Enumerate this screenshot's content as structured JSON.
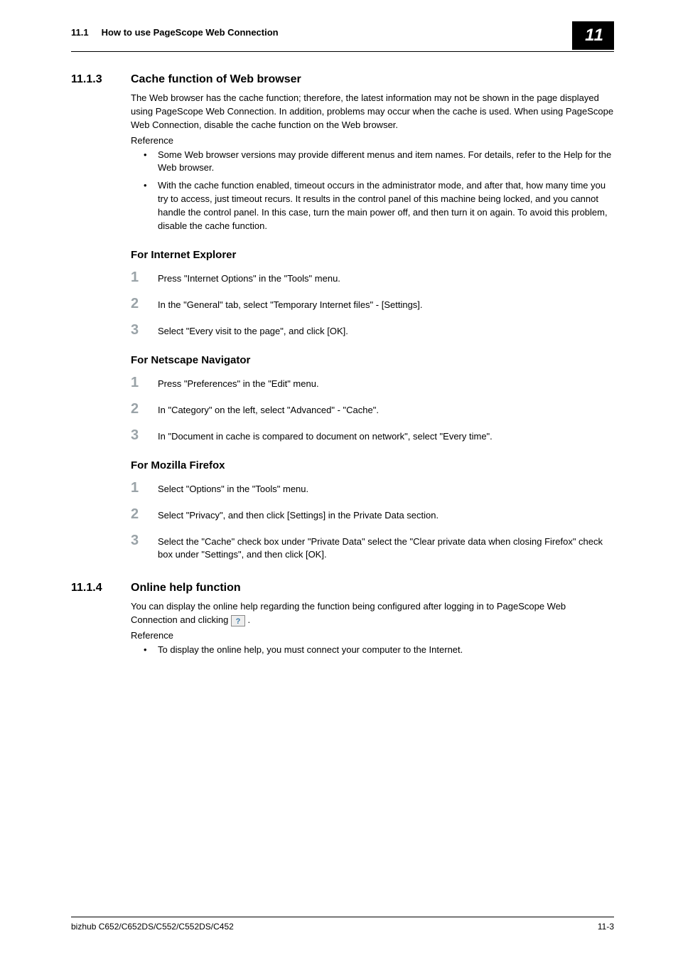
{
  "header": {
    "section_num": "11.1",
    "section_title": "How to use PageScope Web Connection",
    "chapter": "11"
  },
  "sec1": {
    "num": "11.1.3",
    "title": "Cache function of Web browser",
    "intro": "The Web browser has the cache function; therefore, the latest information may not be shown in the page displayed using PageScope Web Connection. In addition, problems may occur when the cache is used. When using PageScope Web Connection, disable the cache function on the Web browser.",
    "reference_label": "Reference",
    "bullets": [
      "Some Web browser versions may provide different menus and item names. For details, refer to the Help for the Web browser.",
      "With the cache function enabled, timeout occurs in the administrator mode, and after that, how many time you try to access, just timeout recurs. It results in the control panel of this machine being locked, and you cannot handle the control panel. In this case, turn the main power off, and then turn it on again. To avoid this problem, disable the cache function."
    ],
    "ie": {
      "title": "For Internet Explorer",
      "steps": [
        "Press \"Internet Options\" in the \"Tools\" menu.",
        "In the \"General\" tab, select \"Temporary Internet files\" - [Settings].",
        "Select \"Every visit to the page\", and click [OK]."
      ]
    },
    "netscape": {
      "title": "For Netscape Navigator",
      "steps": [
        "Press \"Preferences\" in the \"Edit\" menu.",
        "In \"Category\" on the left, select \"Advanced\" - \"Cache\".",
        "In \"Document in cache is compared to document on network\", select \"Every time\"."
      ]
    },
    "firefox": {
      "title": "For Mozilla Firefox",
      "steps": [
        "Select \"Options\" in the \"Tools\" menu.",
        "Select \"Privacy\", and then click [Settings] in the Private Data section.",
        "Select the \"Cache\" check box under \"Private Data\" select the \"Clear private data when closing Firefox\" check box under \"Settings\", and then click [OK]."
      ]
    }
  },
  "sec2": {
    "num": "11.1.4",
    "title": "Online help function",
    "intro_before": "You can display the online help regarding the function being configured after logging in to PageScope Web Connection and clicking ",
    "intro_after": " .",
    "reference_label": "Reference",
    "bullets": [
      "To display the online help, you must connect your computer to the Internet."
    ]
  },
  "footer": {
    "model": "bizhub C652/C652DS/C552/C552DS/C452",
    "page": "11-3"
  }
}
